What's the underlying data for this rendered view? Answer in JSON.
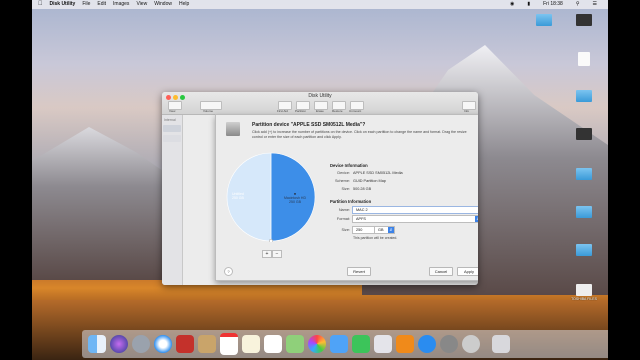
{
  "menubar": {
    "apple": "",
    "app_name": "Disk Utility",
    "menus": [
      "File",
      "Edit",
      "Images",
      "View",
      "Window",
      "Help"
    ],
    "clock": "Fri 18:38"
  },
  "desktop_icons": [
    {
      "label": "",
      "icon": "folder-icon"
    },
    {
      "label": "",
      "icon": "screenshot-icon"
    },
    {
      "label": "",
      "icon": "document-icon"
    },
    {
      "label": "",
      "icon": "folder-icon"
    },
    {
      "label": "",
      "icon": "video-icon"
    },
    {
      "label": "",
      "icon": "folder-icon"
    },
    {
      "label": "",
      "icon": "folder-icon"
    },
    {
      "label": "",
      "icon": "folder-icon"
    },
    {
      "label": "",
      "icon": "folder-icon"
    },
    {
      "label": "TOSHIBA FILES",
      "icon": "drive-icon"
    }
  ],
  "window": {
    "title": "Disk Utility",
    "toolbar": [
      "View",
      "Volume",
      "First Aid",
      "Partition",
      "Erase",
      "Restore",
      "Unmount",
      "Info"
    ],
    "sidebar_header": "Internal"
  },
  "sheet": {
    "title": "Partition device \"APPLE SSD SM0512L Media\"?",
    "description": "Click add (+) to increase the number of partitions on the device. Click on each partition to change the name and format. Drag the resize control or enter the size of each partition and click Apply.",
    "pie": {
      "slices": [
        {
          "label": "Untitled",
          "size": "250 GB",
          "fraction": 0.5,
          "color": "#3d8ee8"
        },
        {
          "label": "Macintosh HD",
          "size": "250 GB",
          "fraction": 0.5,
          "color": "#d6e8fa"
        }
      ]
    },
    "add_button": "+",
    "remove_button": "−",
    "device_info": {
      "heading": "Device Information",
      "rows": [
        {
          "key": "Device:",
          "value": "APPLE SSD SM0512L Media"
        },
        {
          "key": "Scheme:",
          "value": "GUID Partition Map"
        },
        {
          "key": "Size:",
          "value": "500.28 GB"
        }
      ]
    },
    "partition_info": {
      "heading": "Partition Information",
      "name_label": "Name:",
      "name_value": "MAC 2",
      "format_label": "Format:",
      "format_value": "APFS",
      "size_label": "Size:",
      "size_value": "250",
      "size_unit": "GB",
      "note": "This partition will be created."
    },
    "help_button": "?",
    "revert_button": "Revert",
    "cancel_button": "Cancel",
    "apply_button": "Apply"
  },
  "dock": {
    "icons": [
      "finder-icon",
      "siri-icon",
      "launchpad-icon",
      "safari-icon",
      "photo-booth-icon",
      "mail-icon",
      "calendar-icon",
      "notes-icon",
      "reminders-icon",
      "maps-icon",
      "photos-icon",
      "messages-icon",
      "facetime-icon",
      "itunes-icon",
      "ibooks-icon",
      "app-store-icon",
      "system-preferences-icon",
      "disk-utility-icon",
      "trash-icon"
    ]
  }
}
